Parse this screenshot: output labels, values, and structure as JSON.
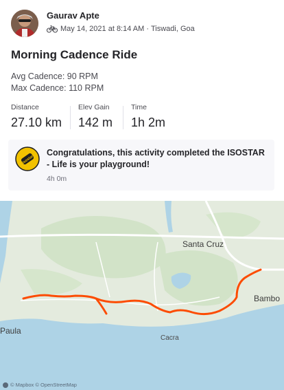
{
  "athlete": {
    "name": "Gaurav Apte",
    "date": "May 14, 2021 at 8:14 AM",
    "separator": "·",
    "location": "Tiswadi, Goa"
  },
  "activity": {
    "title": "Morning Cadence Ride",
    "description_lines": [
      "Avg Cadence: 90 RPM",
      "Max Cadence: 110 RPM"
    ],
    "stats": [
      {
        "label": "Distance",
        "value": "27.10 km"
      },
      {
        "label": "Elev Gain",
        "value": "142 m"
      },
      {
        "label": "Time",
        "value": "1h 2m"
      }
    ]
  },
  "challenge": {
    "text": "Congratulations, this activity completed the ISOSTAR - Life is your playground!",
    "time": "4h 0m",
    "badge_label": "isostar",
    "badge_color": "#f2c200"
  },
  "map": {
    "labels": [
      "Santa Cruz",
      "Bambo",
      "Paula",
      "Cacra"
    ],
    "attribution": "© Mapbox © OpenStreetMap",
    "route_color": "#fc4c02",
    "water_color": "#aed3e6",
    "land_color": "#e4ebde"
  },
  "icons": {
    "activity_type": "bike-icon"
  }
}
